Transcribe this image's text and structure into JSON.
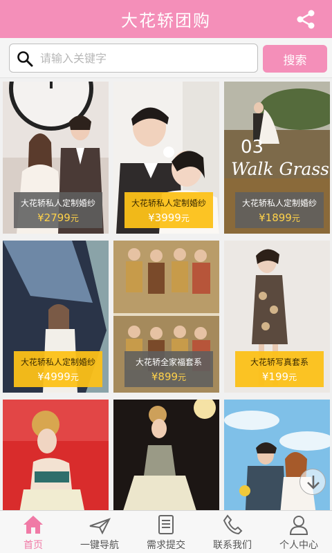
{
  "header": {
    "title": "大花轿团购",
    "share_icon": "share-icon"
  },
  "search": {
    "placeholder": "请输入关键字",
    "value": "",
    "button_label": "搜索",
    "icon": "search-icon"
  },
  "products": [
    {
      "title": "大花轿私人定制婚纱",
      "price": "¥2799",
      "unit": "元",
      "label_style": "gray"
    },
    {
      "title": "大花轿私人定制婚纱",
      "price": "¥3999",
      "unit": "元",
      "label_style": "yellow"
    },
    {
      "title": "大花轿私人定制婚纱",
      "price": "¥1899",
      "unit": "元",
      "label_style": "gray",
      "overlay_number": "03",
      "overlay_text": "Walk Grass"
    },
    {
      "title": "大花轿私人定制婚纱",
      "price": "¥4999",
      "unit": "元",
      "label_style": "yellow"
    },
    {
      "title": "大花轿全家福套系",
      "price": "¥899",
      "unit": "元",
      "label_style": "gray"
    },
    {
      "title": "大花轿写真套系",
      "price": "¥199",
      "unit": "元",
      "label_style": "yellow"
    },
    {
      "title": "",
      "price": "",
      "unit": ""
    },
    {
      "title": "",
      "price": "",
      "unit": ""
    },
    {
      "title": "",
      "price": "",
      "unit": ""
    }
  ],
  "tabs": [
    {
      "label": "首页",
      "icon": "home-icon",
      "active": true
    },
    {
      "label": "一键导航",
      "icon": "navigation-icon",
      "active": false
    },
    {
      "label": "需求提交",
      "icon": "document-icon",
      "active": false
    },
    {
      "label": "联系我们",
      "icon": "phone-icon",
      "active": false
    },
    {
      "label": "个人中心",
      "icon": "user-icon",
      "active": false
    }
  ],
  "colors": {
    "brand_pink": "#f48fb9",
    "label_yellow": "#fcc118",
    "label_gray": "#5f5f5f",
    "active_tab": "#f07aa6"
  }
}
